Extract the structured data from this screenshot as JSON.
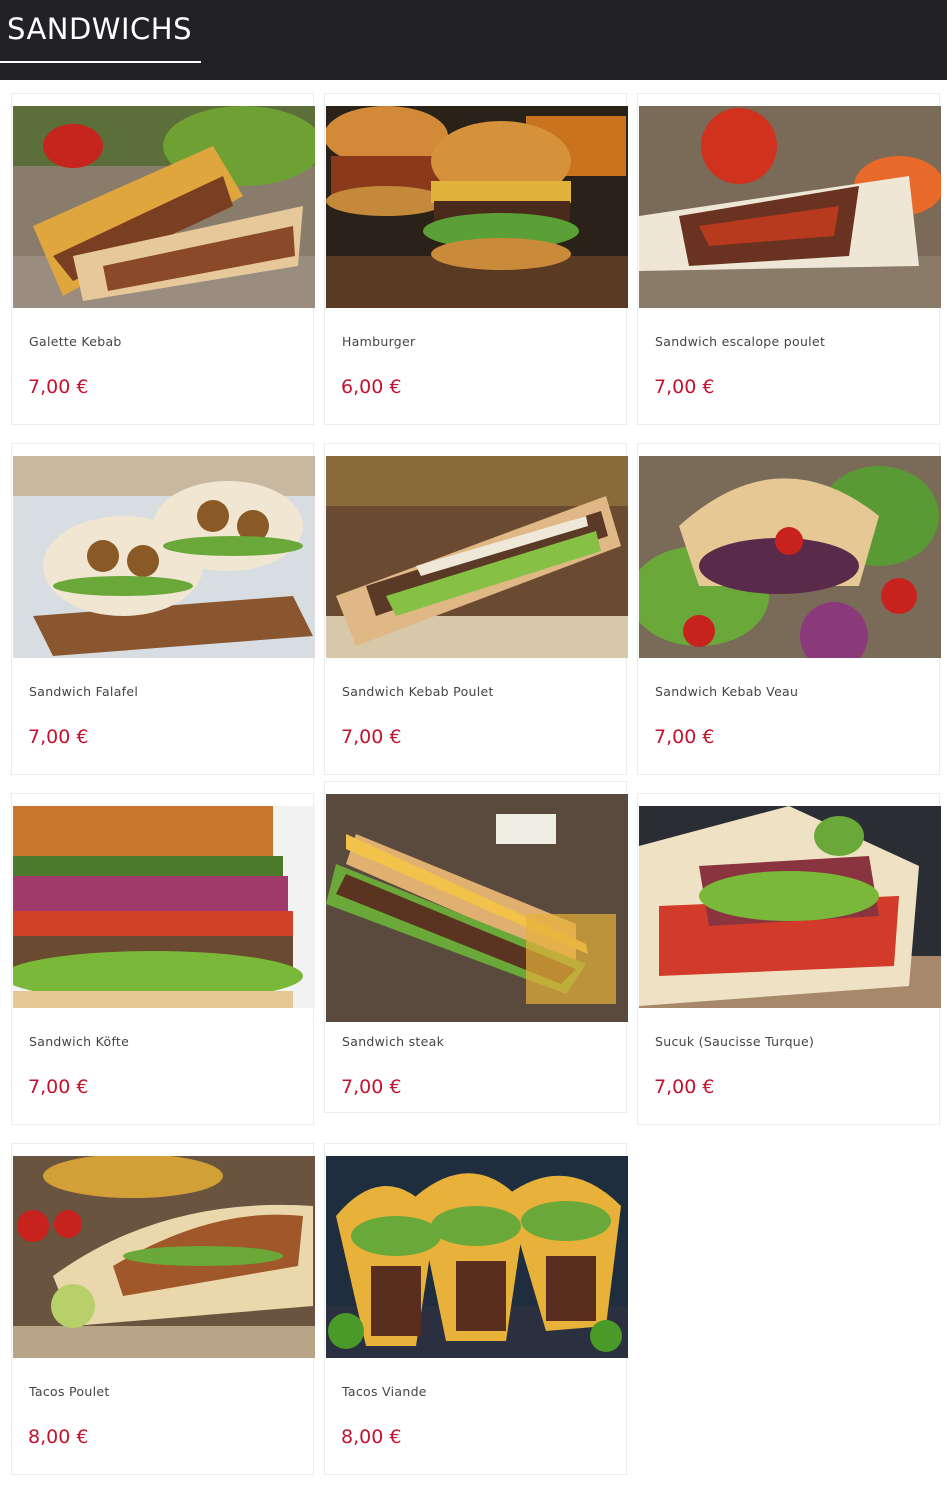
{
  "page": {
    "title": "SANDWICHS"
  },
  "colors": {
    "header_bg": "#222226",
    "price": "#c4122f",
    "card_border": "#ececec"
  },
  "products": [
    {
      "name": "Galette Kebab",
      "price": "7,00 €",
      "image": "wrap-image"
    },
    {
      "name": "Hamburger",
      "price": "6,00 €",
      "image": "burger-image"
    },
    {
      "name": "Sandwich escalope poulet",
      "price": "7,00 €",
      "image": "wrap-image"
    },
    {
      "name": "Sandwich Falafel",
      "price": "7,00 €",
      "image": "pita-image"
    },
    {
      "name": "Sandwich Kebab Poulet",
      "price": "7,00 €",
      "image": "baguette-image"
    },
    {
      "name": "Sandwich Kebab Veau",
      "price": "7,00 €",
      "image": "pita-image"
    },
    {
      "name": "Sandwich Köfte",
      "price": "7,00 €",
      "image": "baguette-image"
    },
    {
      "name": "Sandwich steak",
      "price": "7,00 €",
      "image": "baguette-image"
    },
    {
      "name": "Sucuk (Saucisse Turque)",
      "price": "7,00 €",
      "image": "baguette-image"
    },
    {
      "name": "Tacos Poulet",
      "price": "8,00 €",
      "image": "tacos-image"
    },
    {
      "name": "Tacos Viande",
      "price": "8,00 €",
      "image": "tacos-image"
    }
  ]
}
